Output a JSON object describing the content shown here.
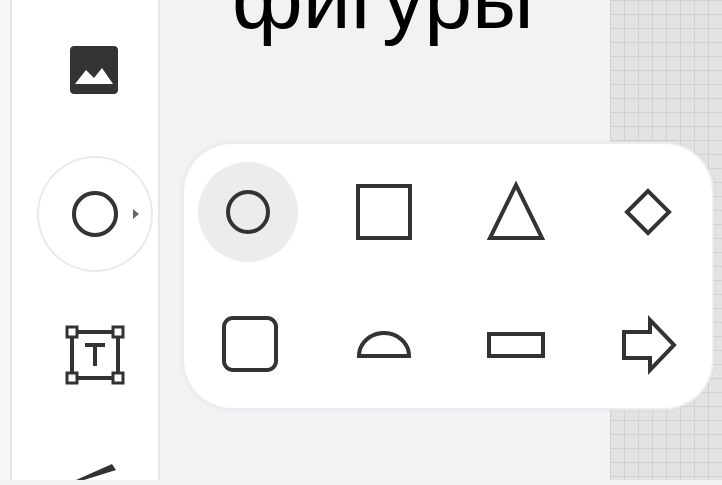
{
  "title": "фигуры",
  "toolbar": {
    "tools": [
      {
        "name": "image-tool",
        "icon": "image-icon"
      },
      {
        "name": "shapes-tool",
        "icon": "circle-icon",
        "active": true
      },
      {
        "name": "text-tool",
        "icon": "text-box-icon"
      },
      {
        "name": "pen-tool",
        "icon": "pen-icon"
      }
    ]
  },
  "shape_menu": {
    "row1": [
      {
        "shape": "circle",
        "icon": "circle-icon",
        "selected": true
      },
      {
        "shape": "square",
        "icon": "square-icon"
      },
      {
        "shape": "triangle",
        "icon": "triangle-icon"
      },
      {
        "shape": "diamond",
        "icon": "diamond-icon"
      }
    ],
    "row2": [
      {
        "shape": "rounded-square",
        "icon": "rounded-square-icon"
      },
      {
        "shape": "semicircle",
        "icon": "semicircle-icon"
      },
      {
        "shape": "rectangle",
        "icon": "rectangle-icon"
      },
      {
        "shape": "arrow",
        "icon": "arrow-right-icon"
      }
    ]
  },
  "colors": {
    "icon": "#333333",
    "selected_bg": "#ececec",
    "popup_bg": "#ffffff",
    "app_bg": "#f1f2f4"
  }
}
